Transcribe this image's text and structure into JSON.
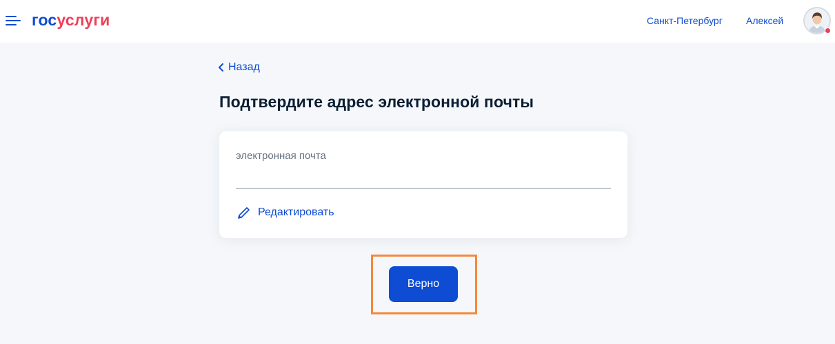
{
  "header": {
    "logo_part1": "гос",
    "logo_part2": "услуги",
    "region": "Санкт-Петербург",
    "user_name": "Алексей"
  },
  "back_link": {
    "label": "Назад"
  },
  "page_title": "Подтвердите адрес электронной почты",
  "email_card": {
    "field_label": "электронная почта",
    "edit_label": "Редактировать"
  },
  "confirm_button": {
    "label": "Верно"
  },
  "colors": {
    "brand_blue": "#0d4cd3",
    "brand_red": "#ee3f58",
    "highlight": "#f5893a",
    "background": "#f5f7fa"
  }
}
